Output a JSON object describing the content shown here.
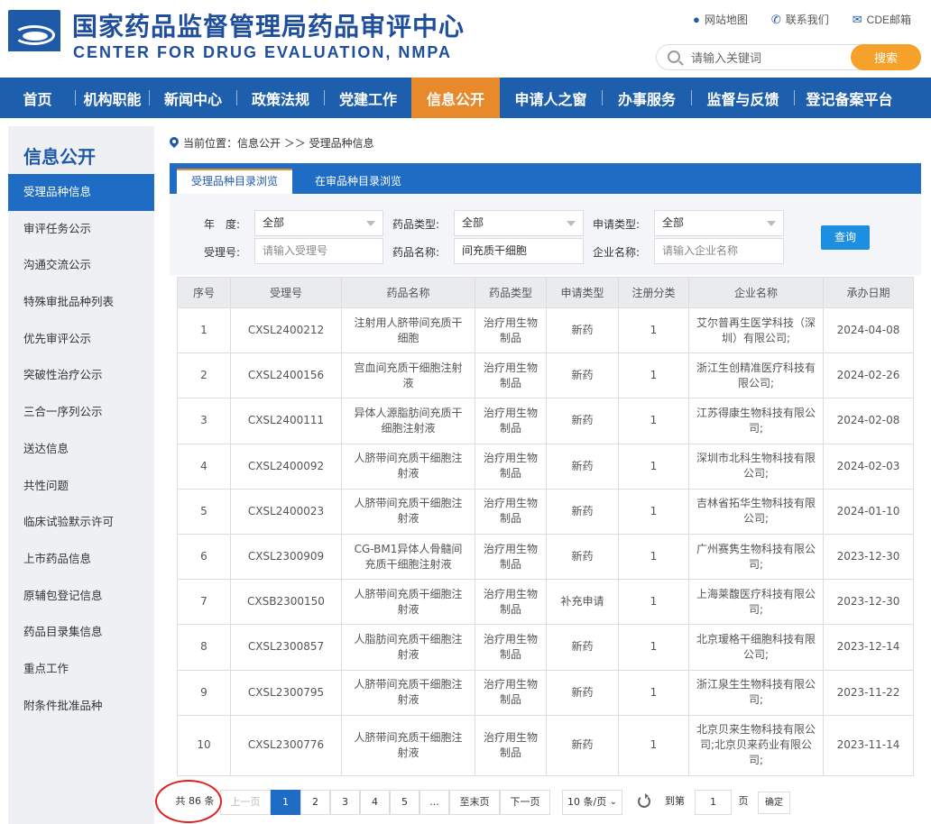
{
  "header": {
    "title_cn": "国家药品监督管理局药品审评中心",
    "title_en": "CENTER FOR DRUG EVALUATION, NMPA",
    "links": [
      {
        "label": "网站地图",
        "icon": "location-pin-icon"
      },
      {
        "label": "联系我们",
        "icon": "phone-icon"
      },
      {
        "label": "CDE邮箱",
        "icon": "mail-icon"
      }
    ],
    "search_placeholder": "请输入关键词",
    "search_button": "搜索"
  },
  "nav": {
    "items": [
      "首页",
      "机构职能",
      "新闻中心",
      "政策法规",
      "党建工作",
      "信息公开",
      "申请人之窗",
      "办事服务",
      "监督与反馈",
      "登记备案平台"
    ],
    "active": "信息公开"
  },
  "sidebar": {
    "title": "信息公开",
    "items": [
      "受理品种信息",
      "审评任务公示",
      "沟通交流公示",
      "特殊审批品种列表",
      "优先审评公示",
      "突破性治疗公示",
      "三合一序列公示",
      "送达信息",
      "共性问题",
      "临床试验默示许可",
      "上市药品信息",
      "原辅包登记信息",
      "药品目录集信息",
      "重点工作",
      "附条件批准品种"
    ],
    "active": "受理品种信息"
  },
  "breadcrumb": "当前位置：信息公开 ＞＞ 受理品种信息",
  "tabs": [
    "受理品种目录浏览",
    "在审品种目录浏览"
  ],
  "filters": {
    "year_label": "年　度:",
    "year_value": "全部",
    "drug_type_label": "药品类型:",
    "drug_type_value": "全部",
    "app_type_label": "申请类型:",
    "app_type_value": "全部",
    "accept_no_label": "受理号:",
    "accept_no_placeholder": "请输入受理号",
    "drug_name_label": "药品名称:",
    "drug_name_value": "间充质干细胞",
    "company_label": "企业名称:",
    "company_placeholder": "请输入企业名称",
    "query_button": "查询"
  },
  "table": {
    "headers": [
      "序号",
      "受理号",
      "药品名称",
      "药品类型",
      "申请类型",
      "注册分类",
      "企业名称",
      "承办日期"
    ],
    "rows": [
      [
        "1",
        "CXSL2400212",
        "注射用人脐带间充质干细胞",
        "治疗用生物制品",
        "新药",
        "1",
        "艾尔普再生医学科技（深圳）有限公司;",
        "2024-04-08"
      ],
      [
        "2",
        "CXSL2400156",
        "宫血间充质干细胞注射液",
        "治疗用生物制品",
        "新药",
        "1",
        "浙江生创精准医疗科技有限公司;",
        "2024-02-26"
      ],
      [
        "3",
        "CXSL2400111",
        "异体人源脂肪间充质干细胞注射液",
        "治疗用生物制品",
        "新药",
        "1",
        "江苏得康生物科技有限公司;",
        "2024-02-08"
      ],
      [
        "4",
        "CXSL2400092",
        "人脐带间充质干细胞注射液",
        "治疗用生物制品",
        "新药",
        "1",
        "深圳市北科生物科技有限公司;",
        "2024-02-03"
      ],
      [
        "5",
        "CXSL2400023",
        "人脐带间充质干细胞注射液",
        "治疗用生物制品",
        "新药",
        "1",
        "吉林省拓华生物科技有限公司;",
        "2024-01-10"
      ],
      [
        "6",
        "CXSL2300909",
        "CG-BM1异体人骨髓间充质干细胞注射液",
        "治疗用生物制品",
        "新药",
        "1",
        "广州赛隽生物科技有限公司;",
        "2023-12-30"
      ],
      [
        "7",
        "CXSB2300150",
        "人脐带间充质干细胞注射液",
        "治疗用生物制品",
        "补充申请",
        "1",
        "上海莱馥医疗科技有限公司;",
        "2023-12-30"
      ],
      [
        "8",
        "CXSL2300857",
        "人脂肪间充质干细胞注射液",
        "治疗用生物制品",
        "新药",
        "1",
        "北京瑷格干细胞科技有限公司;",
        "2023-12-14"
      ],
      [
        "9",
        "CXSL2300795",
        "人脐带间充质干细胞注射液",
        "治疗用生物制品",
        "新药",
        "1",
        "浙江泉生生物科技有限公司;",
        "2023-11-22"
      ],
      [
        "10",
        "CXSL2300776",
        "人脐带间充质干细胞注射液",
        "治疗用生物制品",
        "新药",
        "1",
        "北京贝来生物科技有限公司;北京贝来药业有限公司;",
        "2023-11-14"
      ]
    ]
  },
  "pager": {
    "total": "共 86 条",
    "prev": "上一页",
    "pages": [
      "1",
      "2",
      "3",
      "4",
      "5",
      "..."
    ],
    "last": "至末页",
    "next": "下一页",
    "per_page": "10 条/页",
    "goto_label": "到第",
    "goto_value": "1",
    "page_unit": "页",
    "confirm": "确定"
  },
  "colors": {
    "brand": "#1f5aa8",
    "nav": "#1e5fad",
    "accent": "#e8892c",
    "highlight_circle": "#e02020"
  }
}
